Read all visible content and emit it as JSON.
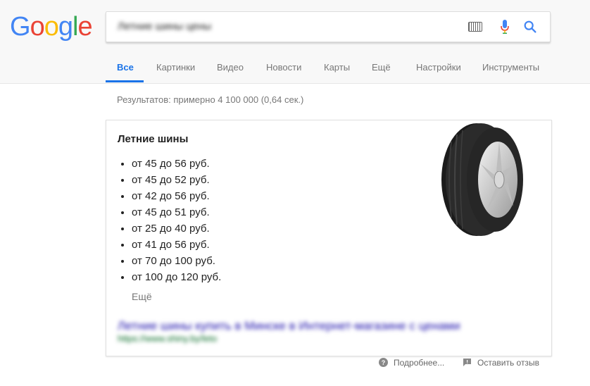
{
  "logo": {
    "letters": [
      "G",
      "o",
      "o",
      "g",
      "l",
      "e"
    ],
    "colors": [
      "#4285F4",
      "#EA4335",
      "#FBBC05",
      "#4285F4",
      "#34A853",
      "#EA4335"
    ]
  },
  "search": {
    "query": "Летние шины цены",
    "icons": [
      "keyboard-icon",
      "mic-icon",
      "search-icon"
    ]
  },
  "tabs": [
    {
      "label": "Все",
      "active": true
    },
    {
      "label": "Картинки",
      "active": false
    },
    {
      "label": "Видео",
      "active": false
    },
    {
      "label": "Новости",
      "active": false
    },
    {
      "label": "Карты",
      "active": false
    },
    {
      "label": "Ещё",
      "active": false
    },
    {
      "label": "Настройки",
      "active": false
    },
    {
      "label": "Инструменты",
      "active": false
    }
  ],
  "results_stats": "Результатов: примерно 4 100 000 (0,64 сек.)",
  "snippet": {
    "title": "Летние шины",
    "items": [
      "от 45 до 56 руб.",
      "от 45 до 52 руб.",
      "от 42 до 56 руб.",
      "от 45 до 51 руб.",
      "от 25 до 40 руб.",
      "от 41 до 56 руб.",
      "от 70 до 100 руб.",
      "от 100 до 120 руб."
    ],
    "more": "Ещё",
    "source_title": "Летние шины купить в Минске в Интернет-магазине с ценами",
    "source_url": "https://www.shiny.by/leto"
  },
  "footer": {
    "more_info": "Подробнее...",
    "feedback": "Оставить отзыв"
  }
}
